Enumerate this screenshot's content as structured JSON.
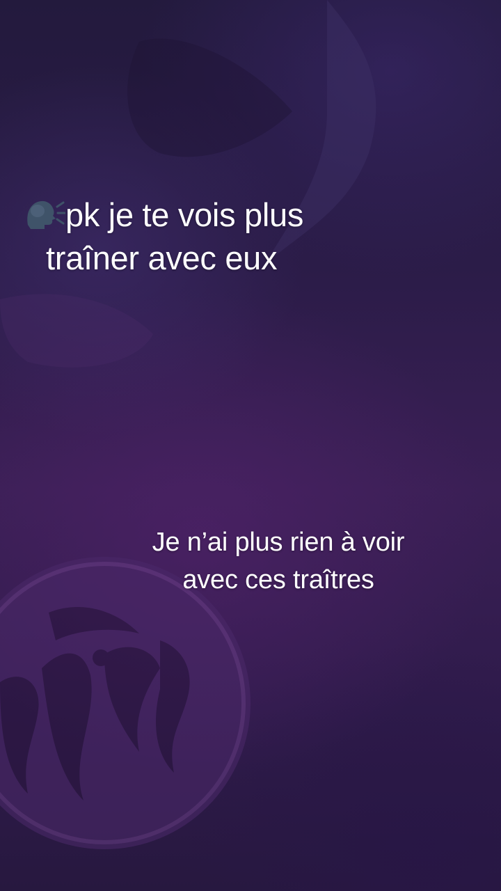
{
  "captions": {
    "question": {
      "icon": "speaking-head-icon",
      "line1": "pk je te vois plus",
      "line2": "traîner avec eux"
    },
    "answer": {
      "line1": "Je n’ai plus rien à voir",
      "line2": "avec ces traîtres"
    }
  },
  "colors": {
    "background": "#2a1a44",
    "text": "#ffffff",
    "emblem": "#6a3d8a"
  }
}
